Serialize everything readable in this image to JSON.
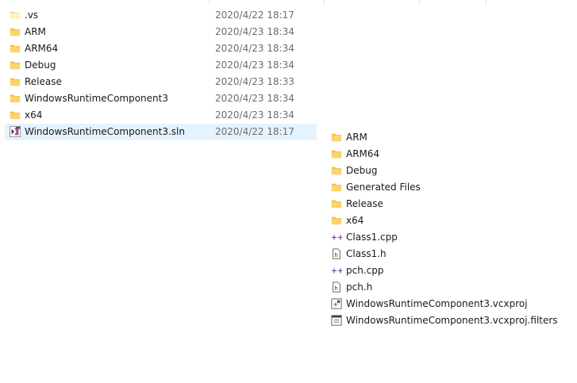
{
  "folder_list": {
    "items": [
      {
        "name": ".vs",
        "date": "2020/4/22 18:17",
        "icon": "hidden-folder-icon"
      },
      {
        "name": "ARM",
        "date": "2020/4/23 18:34",
        "icon": "folder-icon"
      },
      {
        "name": "ARM64",
        "date": "2020/4/23 18:34",
        "icon": "folder-icon"
      },
      {
        "name": "Debug",
        "date": "2020/4/23 18:34",
        "icon": "folder-icon"
      },
      {
        "name": "Release",
        "date": "2020/4/23 18:33",
        "icon": "folder-icon"
      },
      {
        "name": "WindowsRuntimeComponent3",
        "date": "2020/4/23 18:34",
        "icon": "folder-icon"
      },
      {
        "name": "x64",
        "date": "2020/4/23 18:34",
        "icon": "folder-icon"
      },
      {
        "name": "WindowsRuntimeComponent3.sln",
        "date": "2020/4/22 18:17",
        "icon": "visual-studio-solution-icon",
        "selected": true
      }
    ]
  },
  "project_list": {
    "items": [
      {
        "name": "ARM",
        "icon": "folder-icon"
      },
      {
        "name": "ARM64",
        "icon": "folder-icon"
      },
      {
        "name": "Debug",
        "icon": "folder-icon"
      },
      {
        "name": "Generated Files",
        "icon": "folder-icon"
      },
      {
        "name": "Release",
        "icon": "folder-icon"
      },
      {
        "name": "x64",
        "icon": "folder-icon"
      },
      {
        "name": "Class1.cpp",
        "icon": "cpp-file-icon"
      },
      {
        "name": "Class1.h",
        "icon": "header-file-icon"
      },
      {
        "name": "pch.cpp",
        "icon": "cpp-file-icon"
      },
      {
        "name": "pch.h",
        "icon": "header-file-icon"
      },
      {
        "name": "WindowsRuntimeComponent3.vcxproj",
        "icon": "vcxproj-file-icon"
      },
      {
        "name": "WindowsRuntimeComponent3.vcxproj.filters",
        "icon": "filters-file-icon"
      }
    ]
  },
  "colors": {
    "selection": "#e5f3ff",
    "folder": "#fbd46d",
    "date_text": "#6d6d6d",
    "vs_purple": "#68217a"
  }
}
